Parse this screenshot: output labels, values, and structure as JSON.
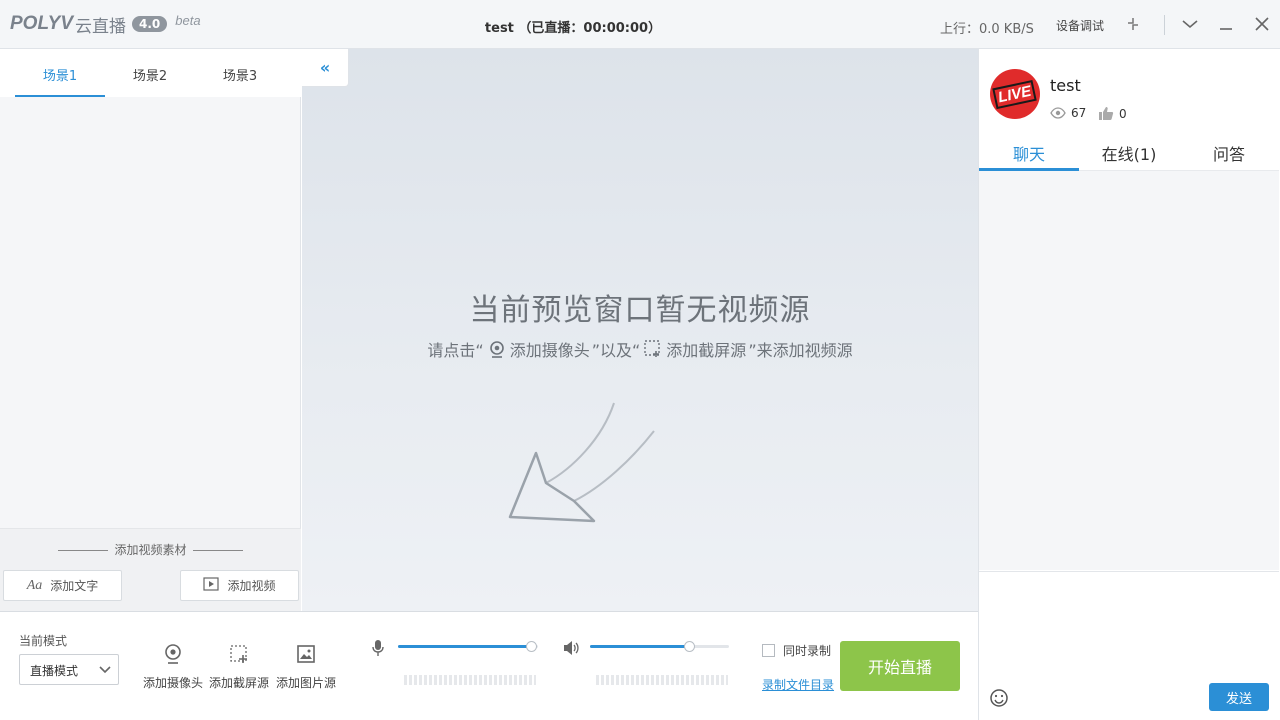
{
  "titlebar": {
    "brand": "POLYV",
    "brand_cn": "云直播",
    "version": "4.0",
    "beta": "beta",
    "title": "test （已直播：00:00:00）",
    "upload": "上行：0.0 KB/S",
    "device_test": "设备调试"
  },
  "scenes": {
    "tabs": [
      "场景1",
      "场景2",
      "场景3"
    ],
    "active": 0
  },
  "left_bottom": {
    "add_material": "添加视频素材",
    "add_text": "添加文字",
    "add_video": "添加视频"
  },
  "preview": {
    "title": "当前预览窗口暂无视频源",
    "sub_prefix": "请点击“",
    "sub_camera": "添加摄像头",
    "sub_mid": "”以及“",
    "sub_screen": "添加截屏源",
    "sub_suffix": "”来添加视频源"
  },
  "bottom": {
    "mode_label": "当前模式",
    "mode_value": "直播模式",
    "add_camera": "添加摄像头",
    "add_screen": "添加截屏源",
    "add_image": "添加图片源",
    "mic_level": 0.96,
    "speaker_level": 0.72,
    "sync_record": "同时录制",
    "record_dir": "录制文件目录",
    "start_live": "开始直播"
  },
  "room": {
    "name": "test",
    "views": "67",
    "likes": "0",
    "avatar_text": "LIVE"
  },
  "chat": {
    "tabs": [
      "聊天",
      "在线(1)",
      "问答"
    ],
    "active": 0,
    "send": "发送"
  },
  "colors": {
    "accent": "#2b8fd6",
    "start_button": "#8dc54a",
    "avatar": "#e02b2b"
  }
}
